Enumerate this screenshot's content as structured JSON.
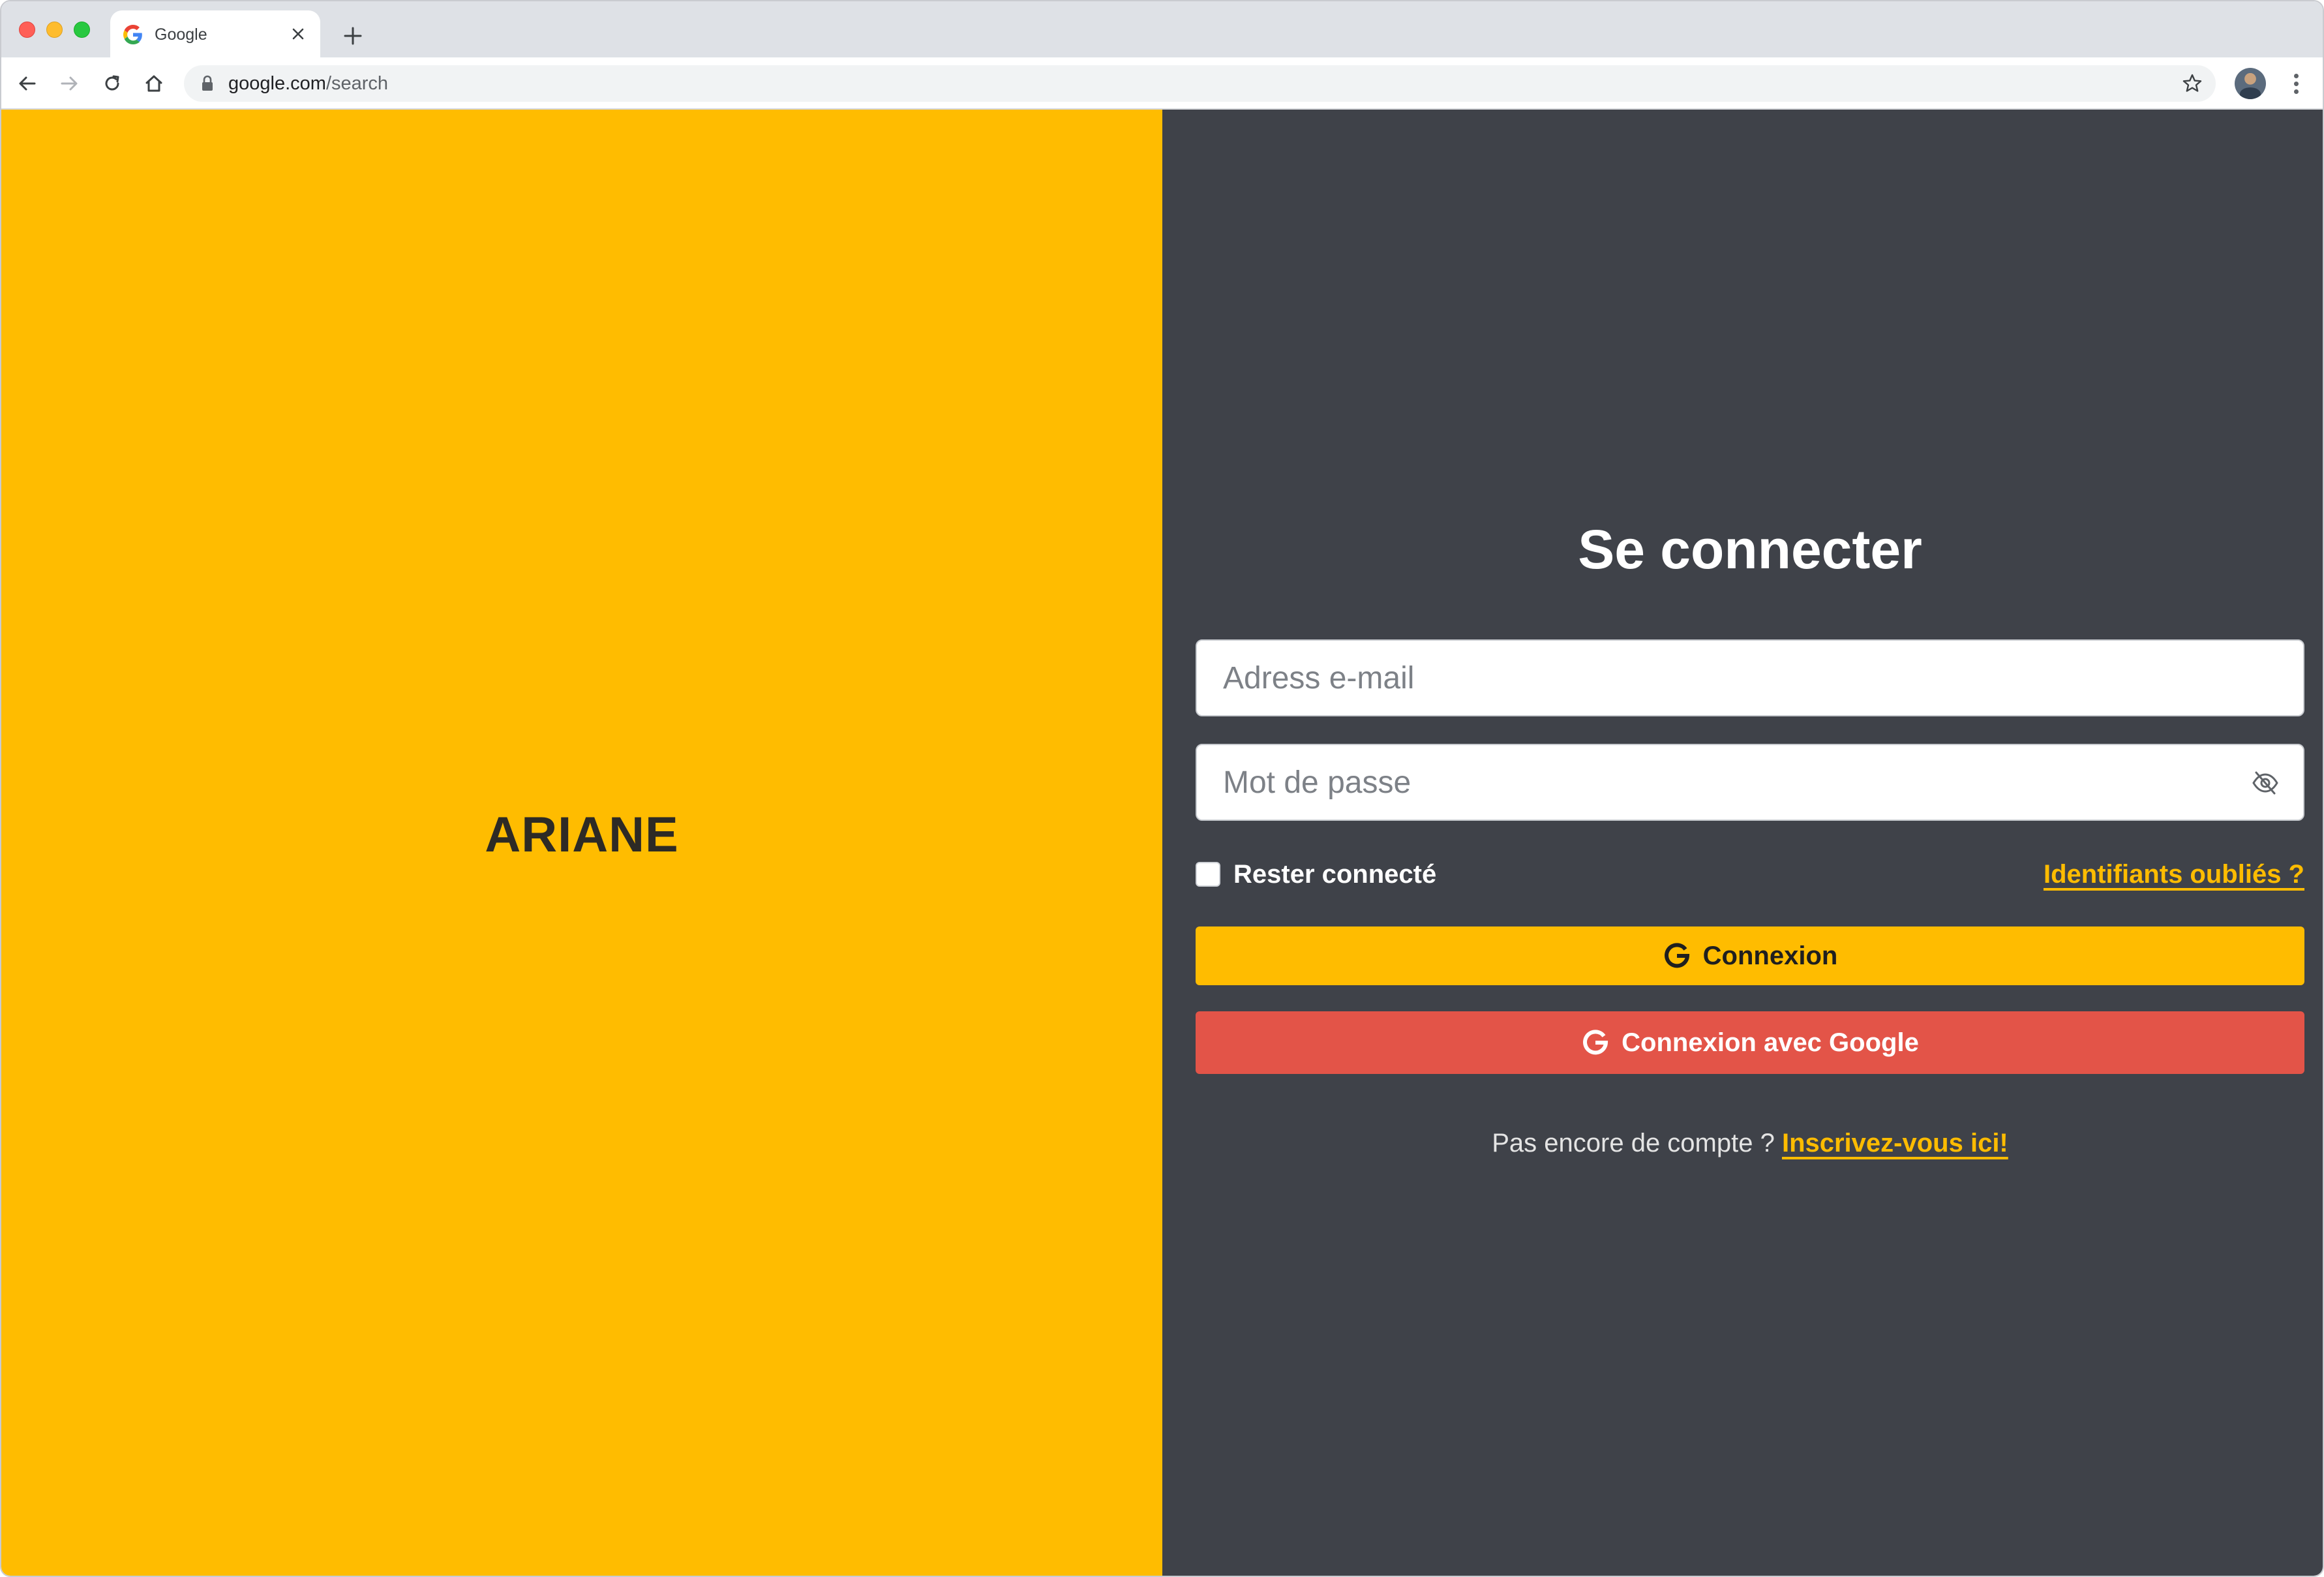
{
  "browser": {
    "tab": {
      "title": "Google",
      "favicon": "google-g-icon",
      "close_icon": "close-icon"
    },
    "new_tab_icon": "plus-icon",
    "nav": {
      "back_icon": "arrow-left-icon",
      "forward_icon": "arrow-right-icon",
      "reload_icon": "reload-icon",
      "home_icon": "home-icon"
    },
    "address": {
      "domain": "google.com",
      "path": "/search",
      "lock_icon": "lock-icon"
    },
    "bookmark_icon": "star-icon",
    "profile_icon": "avatar",
    "menu_icon": "kebab-menu-icon"
  },
  "brand": {
    "name": "ARIANE"
  },
  "login": {
    "heading": "Se connecter",
    "email_placeholder": "Adress e-mail",
    "password_placeholder": "Mot de passe",
    "password_toggle_icon": "eye-slash-icon",
    "remember_label": "Rester connecté",
    "remember_checked": false,
    "forgot_link": "Identifiants oubliés ?",
    "login_button": "Connexion",
    "google_button": "Connexion avec Google",
    "signup_prompt": "Pas encore de compte ?",
    "signup_link": "Inscrivez-vous ici!"
  },
  "colors": {
    "brand_yellow": "#ffbc00",
    "panel_dark": "#3f4249",
    "google_red": "#e35448",
    "text_white": "#ffffff"
  }
}
